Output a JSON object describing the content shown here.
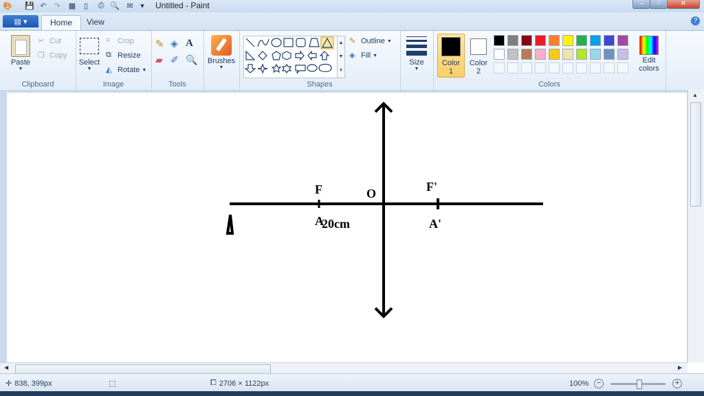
{
  "window": {
    "title": "Untitled - Paint",
    "controls": {
      "minimize": "–",
      "maximize": "▫",
      "close": "✕"
    }
  },
  "tabs": [
    {
      "label": "Home",
      "selected": true
    },
    {
      "label": "View",
      "selected": false
    }
  ],
  "ribbon": {
    "clipboard": {
      "label": "Clipboard",
      "paste": "Paste",
      "cut": "Cut",
      "copy": "Copy"
    },
    "image": {
      "label": "Image",
      "select": "Select",
      "crop": "Crop",
      "resize": "Resize",
      "rotate": "Rotate"
    },
    "tools": {
      "label": "Tools"
    },
    "brushes": {
      "label": "Brushes"
    },
    "shapes": {
      "label": "Shapes",
      "outline": "Outline",
      "fill": "Fill"
    },
    "size": {
      "label": "Size"
    },
    "colors": {
      "label": "Colors",
      "color1": "Color 1",
      "color2": "Color 2",
      "edit": "Edit colors",
      "color1_value": "#000000",
      "color2_value": "#ffffff",
      "palette_row1": [
        "#000000",
        "#7f7f7f",
        "#880015",
        "#ed1c24",
        "#ff7f27",
        "#fff200",
        "#22b14c",
        "#00a2e8",
        "#3f48cc",
        "#a349a4"
      ],
      "palette_row2": [
        "#ffffff",
        "#c3c3c3",
        "#b97a57",
        "#ffaec9",
        "#ffc90e",
        "#efe4b0",
        "#b5e61d",
        "#99d9ea",
        "#7092be",
        "#c8bfe7"
      ]
    }
  },
  "drawing": {
    "labels": {
      "F": "F",
      "O": "O",
      "F_prime": "F'",
      "A": "A",
      "distance": "20cm",
      "A_prime": "A'"
    }
  },
  "status": {
    "cursor_pos": "838, 399px",
    "image_size": "2706 × 1122px",
    "zoom": "100%"
  }
}
